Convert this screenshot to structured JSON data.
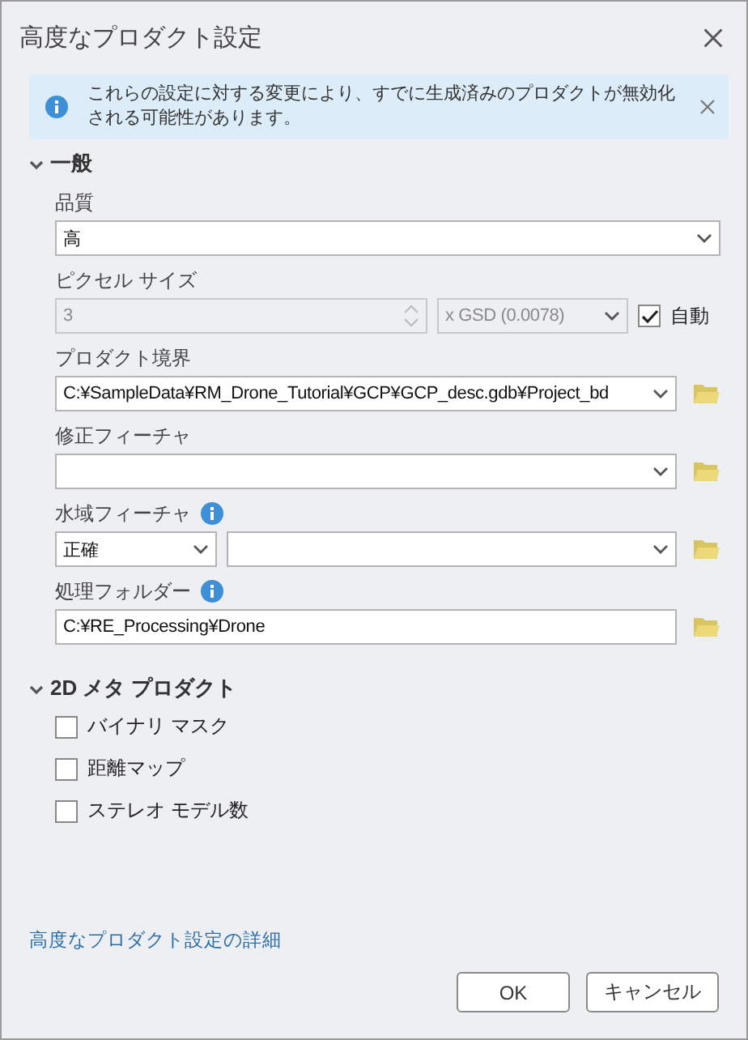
{
  "dialog": {
    "title": "高度なプロダクト設定"
  },
  "banner": {
    "text": "これらの設定に対する変更により、すでに生成済みのプロダクトが無効化される可能性があります。"
  },
  "sections": [
    {
      "title": "一般",
      "expanded": true,
      "fields": [
        {
          "kind": "select",
          "label": "品質",
          "value": "高"
        },
        {
          "kind": "pixel_size",
          "label": "ピクセル サイズ",
          "value": "3",
          "unit": "x GSD (0.0078)",
          "disabled": true,
          "auto_label": "自動",
          "auto_checked": true
        },
        {
          "kind": "path_select",
          "label": "プロダクト境界",
          "value": "C:¥SampleData¥RM_Drone_Tutorial¥GCP¥GCP_desc.gdb¥Project_bd"
        },
        {
          "kind": "path_select",
          "label": "修正フィーチャ"
        },
        {
          "kind": "dual_select",
          "label": "水域フィーチャ",
          "info": true,
          "value": "正確"
        },
        {
          "kind": "path_input",
          "label": "処理フォルダー",
          "info": true,
          "value": "C:¥RE_Processing¥Drone"
        }
      ]
    },
    {
      "title": "2D メタ プロダクト",
      "expanded": true,
      "checkboxes": [
        {
          "label": "バイナリ マスク",
          "checked": false
        },
        {
          "label": "距離マップ",
          "checked": false
        },
        {
          "label": "ステレオ モデル数",
          "checked": false
        }
      ]
    }
  ],
  "link": "高度なプロダクト設定の詳細",
  "buttons": [
    {
      "label": "OK"
    },
    {
      "label": "キャンセル"
    }
  ]
}
